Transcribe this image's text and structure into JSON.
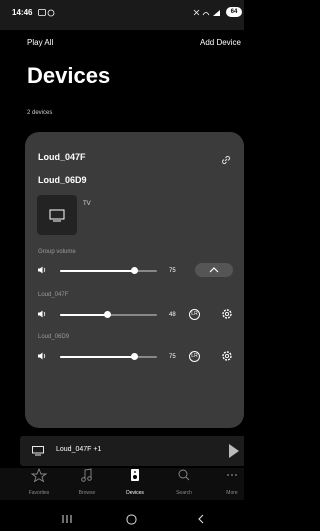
{
  "status_bar": {
    "time": "14:46",
    "battery": "64"
  },
  "header": {
    "play_all": "Play All",
    "add_device": "Add Device"
  },
  "page_title": "Devices",
  "device_count": "2 devices",
  "group": {
    "names": [
      "Loud_047F",
      "Loud_06D9"
    ],
    "tv_label": "TV",
    "group_volume_label": "Group volume",
    "group_volume": 75,
    "speakers": [
      {
        "label": "Loud_047F",
        "volume": 48
      },
      {
        "label": "Loud_06D9",
        "volume": 75
      }
    ]
  },
  "now_playing": {
    "text": "Loud_047F +1"
  },
  "nav": {
    "items": [
      {
        "label": "Favorites",
        "icon": "star-icon",
        "active": false
      },
      {
        "label": "Browse",
        "icon": "music-note-icon",
        "active": false
      },
      {
        "label": "Devices",
        "icon": "speaker-icon",
        "active": true
      },
      {
        "label": "Search",
        "icon": "search-icon",
        "active": false
      },
      {
        "label": "More",
        "icon": "more-icon",
        "active": false
      }
    ]
  },
  "colors": {
    "background": "#000000",
    "card": "#3b3b3b",
    "accent": "#ffffff"
  }
}
